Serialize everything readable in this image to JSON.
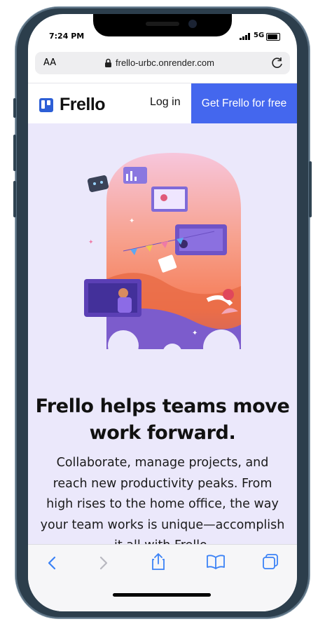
{
  "status": {
    "time": "7:24 PM",
    "network": "5G"
  },
  "browser": {
    "aa_label": "AA",
    "url": "frello-urbc.onrender.com"
  },
  "nav": {
    "brand": "Frello",
    "login": "Log in",
    "cta": "Get Frello for free"
  },
  "hero": {
    "headline_line1": "Frello helps teams move",
    "headline_line2": "work forward.",
    "sub_lines": [
      "Collaborate, manage projects, and",
      "reach new productivity peaks. From",
      "high rises to the home office, the way",
      "your team works is unique—accomplish",
      "it all with Frello."
    ]
  },
  "toolbar": {
    "icons": [
      "back-icon",
      "forward-icon",
      "share-icon",
      "bookmarks-icon",
      "tabs-icon"
    ]
  },
  "colors": {
    "brand": "#2d5fd6",
    "cta": "#4467ee",
    "hero_bg": "#ebe8fb",
    "toolbar_tint": "#3b82f6"
  }
}
